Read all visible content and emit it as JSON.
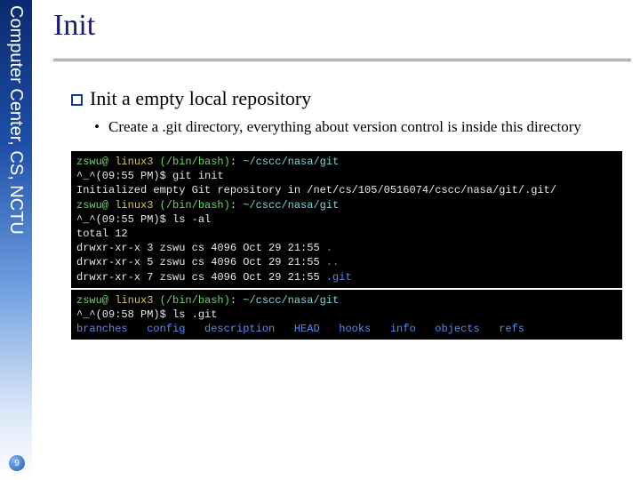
{
  "sidebar": {
    "label": "Computer Center, CS, NCTU"
  },
  "page_number": "9",
  "title": "Init",
  "bullet_main": "Init a empty local repository",
  "bullet_sub": "Create a .git directory, everything about version control is inside this directory",
  "term1": {
    "prompt_user": "zswu@",
    "prompt_host": " linux3 ",
    "prompt_shell": "(/bin/bash)",
    "prompt_sep": ": ",
    "prompt_path": "~/cscc/nasa/git",
    "line2_prefix": "^_^(09:55 PM)$ ",
    "line2_cmd": "git init",
    "line3": "Initialized empty Git repository in /net/cs/105/0516074/cscc/nasa/git/.git/",
    "line5_prefix": "^_^(09:55 PM)$ ",
    "line5_cmd": "ls -al",
    "line6": "total 12",
    "line7": "drwxr-xr-x 3 zswu cs 4096 Oct 29 21:55 ",
    "line7_dot": ".",
    "line8": "drwxr-xr-x 5 zswu cs 4096 Oct 29 21:55 ",
    "line8_dot": "..",
    "line9": "drwxr-xr-x 7 zswu cs 4096 Oct 29 21:55 ",
    "line9_dot": ".git"
  },
  "term2": {
    "prompt_user": "zswu@",
    "prompt_host": " linux3 ",
    "prompt_shell": "(/bin/bash)",
    "prompt_sep": ": ",
    "prompt_path": "~/cscc/nasa/git",
    "line2_prefix": "^_^(09:58 PM)$ ",
    "line2_cmd": "ls .git",
    "listing": "branches   config   description   HEAD   hooks   info   objects   refs"
  }
}
